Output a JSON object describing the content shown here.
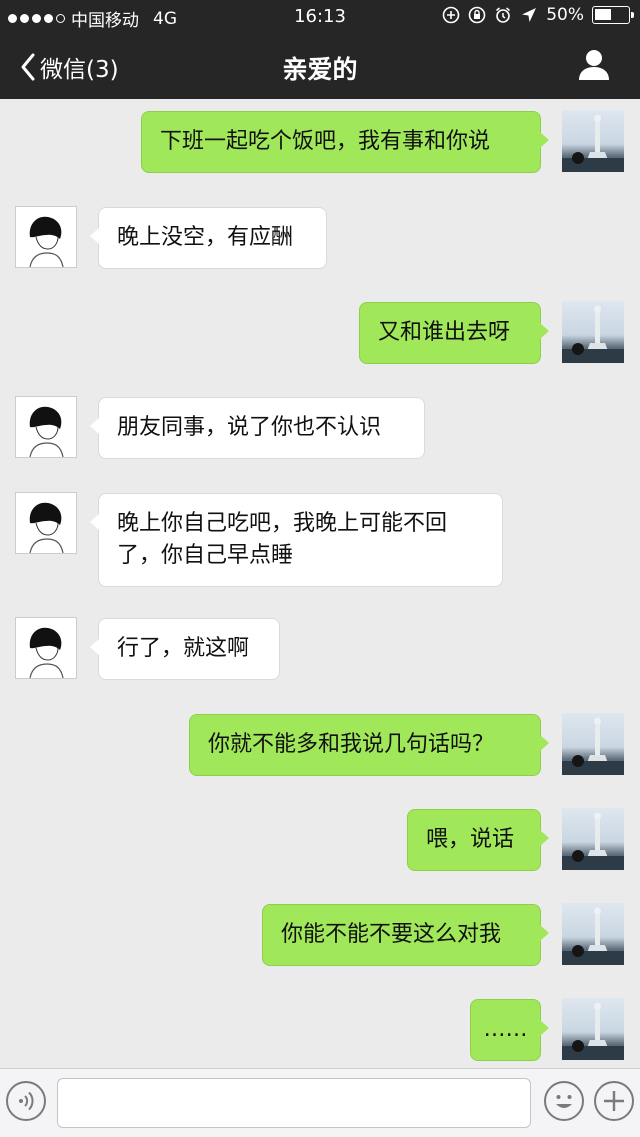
{
  "status_bar": {
    "carrier": "中国移动",
    "network": "4G",
    "time": "16:13",
    "battery": "50%",
    "battery_level": 0.5
  },
  "nav": {
    "back_label": "微信(3)",
    "title": "亲爱的"
  },
  "messages": [
    {
      "from": "me",
      "text": "下班一起吃个饭吧，我有事和你说"
    },
    {
      "from": "them",
      "text": "晚上没空，有应酬"
    },
    {
      "from": "me",
      "text": "又和谁出去呀"
    },
    {
      "from": "them",
      "text": "朋友同事，说了你也不认识"
    },
    {
      "from": "them",
      "text": "晚上你自己吃吧，我晚上可能不回了，你自己早点睡"
    },
    {
      "from": "them",
      "text": "行了，就这啊"
    },
    {
      "from": "me",
      "text": "你就不能多和我说几句话吗？"
    },
    {
      "from": "me",
      "text": "喂，说话"
    },
    {
      "from": "me",
      "text": "你能不能不要这么对我"
    },
    {
      "from": "me",
      "text": "……"
    }
  ],
  "input": {
    "value": "",
    "placeholder": ""
  },
  "colors": {
    "my_bubble": "#a0e75a",
    "their_bubble": "#ffffff",
    "nav_bg": "#262626",
    "chat_bg": "#ebebeb"
  }
}
